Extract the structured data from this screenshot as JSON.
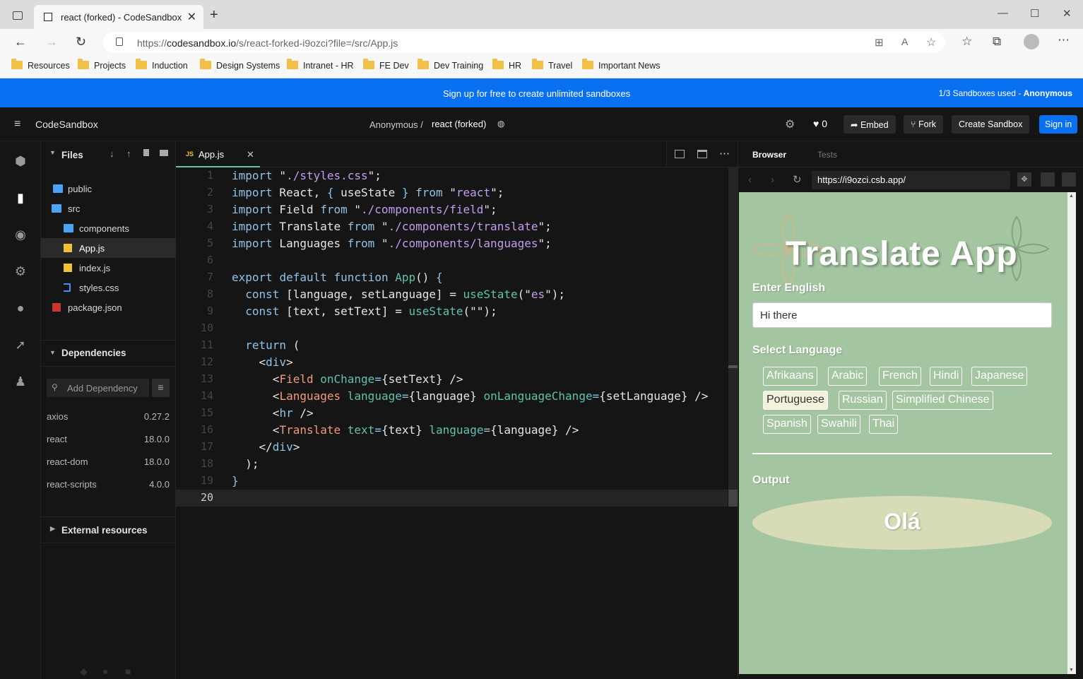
{
  "browser": {
    "tab_title": "react (forked) - CodeSandbox",
    "url_prefix": "https://",
    "url_host": "codesandbox.io",
    "url_path": "/s/react-forked-i9ozci?file=/src/App.js",
    "bookmarks": [
      "Resources",
      "Projects",
      "Induction",
      "Design Systems",
      "Intranet - HR",
      "FE Dev",
      "Dev Training",
      "HR",
      "Travel",
      "Important News"
    ]
  },
  "banner": {
    "signup_text": "Sign up for free to create unlimited sandboxes",
    "usage_text": "1/3 Sandboxes used - ",
    "usage_user": "Anonymous"
  },
  "header": {
    "app_name": "CodeSandbox",
    "owner": "Anonymous /",
    "sandbox_name": "react (forked)",
    "like_count": "0",
    "embed_label": "Embed",
    "fork_label": "Fork",
    "create_label": "Create Sandbox",
    "signin_label": "Sign in"
  },
  "sidebar": {
    "files_title": "Files",
    "files": [
      "public",
      "src",
      "components",
      "App.js",
      "index.js",
      "styles.css",
      "package.json"
    ],
    "deps_title": "Dependencies",
    "add_dep_placeholder": "Add Dependency",
    "dependencies": [
      {
        "name": "axios",
        "version": "0.27.2"
      },
      {
        "name": "react",
        "version": "18.0.0"
      },
      {
        "name": "react-dom",
        "version": "18.0.0"
      },
      {
        "name": "react-scripts",
        "version": "4.0.0"
      }
    ],
    "external_title": "External resources"
  },
  "editor": {
    "tab_label": "App.js",
    "line_numbers": [
      "1",
      "2",
      "3",
      "4",
      "5",
      "6",
      "7",
      "8",
      "9",
      "10",
      "11",
      "12",
      "13",
      "14",
      "15",
      "16",
      "17",
      "18",
      "19",
      "20"
    ]
  },
  "preview": {
    "tab_browser": "Browser",
    "tab_tests": "Tests",
    "url": "https://i9ozci.csb.app/",
    "app": {
      "title": "Translate App",
      "enter_label": "Enter English",
      "input_value": "Hi there",
      "select_label": "Select Language",
      "languages": [
        "Afrikaans",
        "Arabic",
        "French",
        "Hindi",
        "Japanese",
        "Portuguese",
        "Russian",
        "Simplified Chinese",
        "Spanish",
        "Swahili",
        "Thai"
      ],
      "selected_language": "Portuguese",
      "output_label": "Output",
      "output_value": "Olá"
    }
  }
}
